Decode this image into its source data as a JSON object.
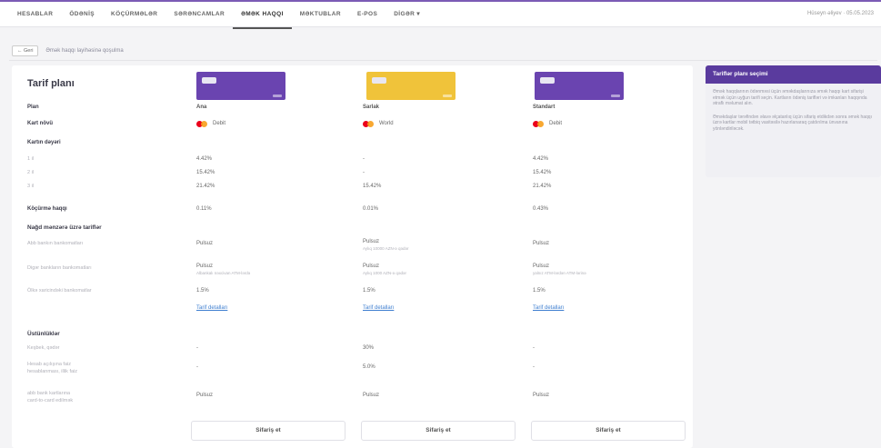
{
  "nav": {
    "items": [
      "HESABLAR",
      "ÖDƏNİŞ",
      "KÖÇÜRMƏLƏR",
      "SƏRƏNCAMLAR",
      "ƏMƏK HAQQI",
      "MƏKTUBLAR",
      "E-POS",
      "DİGƏR"
    ],
    "active_index": 4,
    "right_text": "Hüseyn·əliyev · 05.05.2023"
  },
  "breadcrumb": {
    "back": "← Geri",
    "text": "Əmək haqqı layihəsinə qoşulma"
  },
  "plans": {
    "title": "Tarif planı",
    "columns": [
      {
        "name": "Ana",
        "scheme": "Debit",
        "rate_1": "4.42%",
        "rate_2": "15.42%",
        "rate_3": "21.42%",
        "commission": "0.11%",
        "own_bank": "Pulsuz",
        "other_bank": "Pulsuz",
        "other_bank_note": "Albankalı nəxcivan ATM-lərdə",
        "foreign": "1.5%",
        "details": "Tarif detalları",
        "cashback": "-",
        "account_fee": "-",
        "add_card": "Pulsuz",
        "order": "Sifariş et",
        "card_color": "#6a44b0"
      },
      {
        "name": "Sarlak",
        "scheme": "World",
        "rate_1": "-",
        "rate_2": "-",
        "rate_3": "15.42%",
        "commission": "0.01%",
        "own_bank": "Pulsuz",
        "own_bank_note": "Aylıq 10000 AZN-ə qədər",
        "other_bank": "Pulsuz",
        "other_bank_note": "Aylıq 1000 AZN-ə qədər",
        "foreign": "1.5%",
        "details": "Tarif detalları",
        "cashback": "30%",
        "account_fee": "5.0%",
        "add_card": "Pulsuz",
        "order": "Sifariş et",
        "card_color": "#f0c33a"
      },
      {
        "name": "Standart",
        "scheme": "Debit",
        "rate_1": "4.42%",
        "rate_2": "15.42%",
        "rate_3": "21.42%",
        "commission": "0.43%",
        "own_bank": "Pulsuz",
        "other_bank": "Pulsuz",
        "other_bank_note": "yalnız ATM-lərdən ATM-lərinə",
        "foreign": "1.5%",
        "details": "Tarif detalları",
        "cashback": "-",
        "account_fee": "-",
        "add_card": "Pulsuz",
        "order": "Sifariş et",
        "card_color": "#6a44b0"
      }
    ]
  },
  "rows": {
    "plan": "Plan",
    "card_type": "Kart növü",
    "card_rates": "Kartın dəyəri",
    "rate_1": "1 il",
    "rate_2": "2 il",
    "rate_3": "3 il",
    "commission": "Köçürmə haqqı",
    "cash_section": "Nağd mənzərə üzrə tariflər",
    "own_bank": "Abb bankın bankomatları",
    "other_bank": "Digər bankların bankomatları",
    "foreign": "Ölkə xaricindəki bankomatlar",
    "bonus_section": "Üstünlüklər",
    "cashback": "Keşbek, qədər",
    "account_fee_1": "Hesab açılışına faiz",
    "account_fee_2": "hesablanması, illik faiz",
    "add_card_1": "abb bank kartlarına",
    "add_card_2": "card-to-card edilmək"
  },
  "side": {
    "title": "Tariflər planı seçimi",
    "p1": "Əmək haqqlarının ödənməsi üçün əməkdaşlarınıza əmək haqqı kart sifarişi etmək üçün uyğun tarifi seçin. Kartların ödəniş tarifləri və imkanları haqqında ətraflı məlumat alın.",
    "p2": "Əməkdaşlar tərəfindən əlavə əlçatanlıq üçün sifariş etdikdən sonra əmək haqqı üzrə kartlar mobil tətbiq vasitəsilə hazırlanaraq çatdırılma ünvanına yönləndiriləcək."
  },
  "colors": {
    "brand": "#5a3b9e",
    "nav_border": "#7b5bb5",
    "link": "#3f7fd0",
    "card_purple": "#6a44b0",
    "card_yellow": "#f0c33a"
  }
}
